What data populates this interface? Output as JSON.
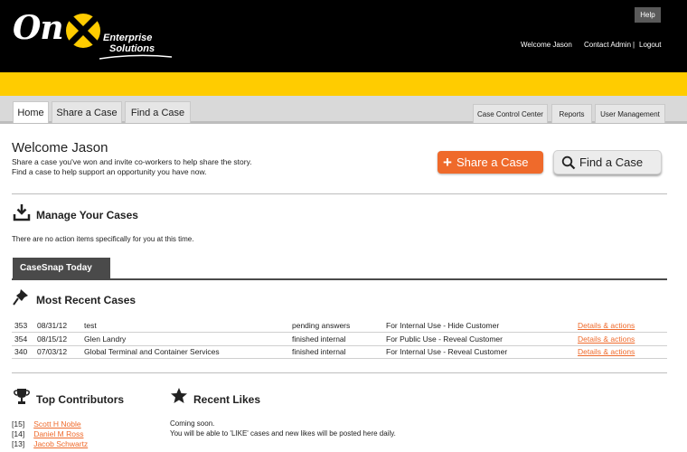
{
  "header": {
    "logo": {
      "on": "On",
      "enterprise": "Enterprise",
      "solutions": "Solutions"
    },
    "help_label": "Help",
    "welcome_text": "Welcome Jason",
    "contact_admin_label": "Contact Admin",
    "separator": "|",
    "logout_label": "Logout"
  },
  "nav": {
    "tabs": [
      {
        "label": "Home",
        "active": true
      },
      {
        "label": "Share a Case",
        "active": false
      },
      {
        "label": "Find a Case",
        "active": false
      }
    ],
    "right_tabs": [
      {
        "label": "Case Control Center"
      },
      {
        "label": "Reports"
      },
      {
        "label": "User Management"
      }
    ]
  },
  "main": {
    "title": "Welcome Jason",
    "intro_lines": [
      "Share a case you've won and invite co-workers to help share the story.",
      "Find a case to help support an opportunity you have now."
    ],
    "share_button_label": "Share a Case",
    "find_button_label": "Find a Case",
    "manage": {
      "title": "Manage Your Cases",
      "note": "There are no action items specifically for you at this time."
    },
    "casesnap_tab_label": "CaseSnap Today",
    "recent": {
      "title": "Most Recent Cases",
      "rows": [
        {
          "id": "353",
          "date": "08/31/12",
          "name": "test",
          "status": "pending answers",
          "use": "For Internal Use - Hide Customer",
          "link": "Details & actions"
        },
        {
          "id": "354",
          "date": "08/15/12",
          "name": "Glen Landry",
          "status": "finished internal",
          "use": "For Public Use - Reveal Customer",
          "link": "Details & actions"
        },
        {
          "id": "340",
          "date": "07/03/12",
          "name": "Global Terminal and Container Services",
          "status": "finished internal",
          "use": "For Internal Use - Reveal Customer",
          "link": "Details & actions"
        }
      ]
    },
    "contributors": {
      "title": "Top Contributors",
      "items": [
        {
          "count": "[15]",
          "name": "Scott H Noble"
        },
        {
          "count": "[14]",
          "name": "Daniel M Ross"
        },
        {
          "count": "[13]",
          "name": "Jacob Schwartz"
        }
      ]
    },
    "likes": {
      "title": "Recent Likes",
      "lines": [
        "Coming soon.",
        "You will be able to 'LIKE' cases and new likes will be posted here daily."
      ]
    }
  },
  "colors": {
    "header_bg": "#000000",
    "brand_yellow": "#ffcc00",
    "accent_orange": "#ef6a2b",
    "tab_gray": "#d9d9d9",
    "casesnap_tab": "#4a4a4a"
  },
  "icons": {
    "logo_mark": "x-circle-logo-icon",
    "manage": "download-tray-icon",
    "recent": "pushpin-icon",
    "contributors": "trophy-icon",
    "likes": "star-icon",
    "find": "magnifier-icon"
  }
}
